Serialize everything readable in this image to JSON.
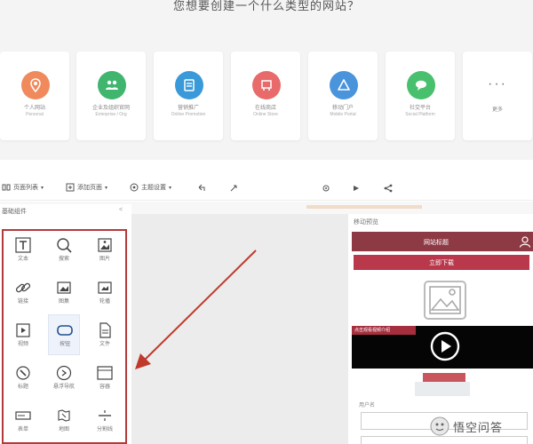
{
  "headline": "您想要创建一个什么类型的网站？",
  "site_types": [
    {
      "name": "个人网站",
      "sub": "Personal",
      "color": "#f08a5d",
      "icon": "map-pin-icon"
    },
    {
      "name": "企业及组织官网",
      "sub": "Enterprise / Org",
      "color": "#3fb56e",
      "icon": "people-icon"
    },
    {
      "name": "营销推广",
      "sub": "Online Promotion",
      "color": "#3a9ad9",
      "icon": "document-icon"
    },
    {
      "name": "在线商店",
      "sub": "Online Store",
      "color": "#e86a6a",
      "icon": "cart-icon"
    },
    {
      "name": "移动门户",
      "sub": "Mobile Portal",
      "color": "#4a94dc",
      "icon": "triangle-icon"
    },
    {
      "name": "社交平台",
      "sub": "Social Platform",
      "color": "#49c06e",
      "icon": "chat-icon"
    }
  ],
  "more_card": {
    "dots": "···",
    "label": "更多"
  },
  "toolbar": {
    "items": [
      {
        "label": "页面列表",
        "icon": "pages-icon"
      },
      {
        "label": "添加页面",
        "icon": "add-page-icon"
      },
      {
        "label": "主题设置",
        "icon": "theme-icon"
      }
    ],
    "tools": [
      "undo-icon",
      "redo-icon",
      "settings-icon",
      "preview-icon",
      "share-icon"
    ]
  },
  "left_panel": {
    "title": "基础组件",
    "collapse": "<",
    "components": [
      {
        "label": "文本",
        "icon": "text-icon"
      },
      {
        "label": "搜索",
        "icon": "search-icon"
      },
      {
        "label": "图片",
        "icon": "image-icon"
      },
      {
        "label": "链接",
        "icon": "link-icon"
      },
      {
        "label": "图集",
        "icon": "gallery-icon"
      },
      {
        "label": "轮播",
        "icon": "carousel-icon"
      },
      {
        "label": "视频",
        "icon": "video-icon"
      },
      {
        "label": "按钮",
        "icon": "button-icon"
      },
      {
        "label": "文件",
        "icon": "file-icon"
      },
      {
        "label": "标题",
        "icon": "title-icon"
      },
      {
        "label": "悬浮导航",
        "icon": "float-nav-icon"
      },
      {
        "label": "容器",
        "icon": "container-icon"
      },
      {
        "label": "表单",
        "icon": "form-icon"
      },
      {
        "label": "地图",
        "icon": "map-icon"
      },
      {
        "label": "分割线",
        "icon": "divider-icon"
      }
    ]
  },
  "preview": {
    "title": "移动预览",
    "header_text": "网站标题",
    "button_text": "立即下载",
    "video_tag": "点击观看视频介绍",
    "label": "用户名"
  },
  "watermark": {
    "text": "悟空问答"
  },
  "colors": {
    "box_border": "#b23a3a",
    "arrow": "#c0392b",
    "header": "#8e3a44",
    "button": "#b9384c"
  }
}
